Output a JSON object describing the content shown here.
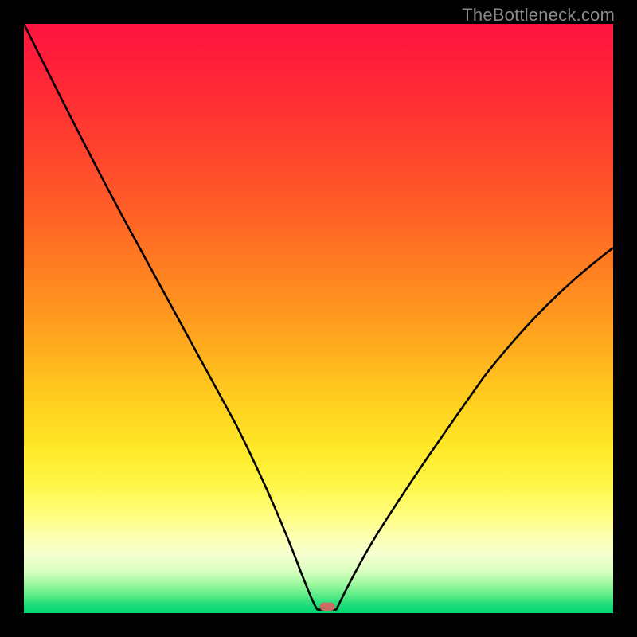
{
  "attribution": "TheBottleneck.com",
  "chart_data": {
    "type": "line",
    "title": "",
    "xlabel": "",
    "ylabel": "",
    "xlim": [
      0,
      100
    ],
    "ylim": [
      0,
      100
    ],
    "grid": false,
    "legend": false,
    "note": "Background encodes a smooth red→yellow→green vertical gradient (bottleneck severity). The black curve is a V-shape bottoming near x≈51 (y≈0) with a short flat segment, left branch starting at top-left, right branch rising to ~60 at the right edge.",
    "series": [
      {
        "name": "curve",
        "x": [
          0,
          5,
          10,
          15,
          20,
          25,
          30,
          35,
          40,
          45,
          47,
          49,
          51,
          53,
          55,
          60,
          65,
          70,
          75,
          80,
          85,
          90,
          95,
          100
        ],
        "y": [
          100,
          89,
          78,
          67,
          57,
          47,
          37,
          28,
          19,
          10,
          6,
          2,
          0,
          0,
          3,
          10,
          18,
          25,
          32,
          39,
          45,
          51,
          56,
          61
        ]
      }
    ],
    "marker": {
      "x": 51.5,
      "y": 0.8,
      "color": "#cf6a62",
      "shape": "pill"
    }
  }
}
